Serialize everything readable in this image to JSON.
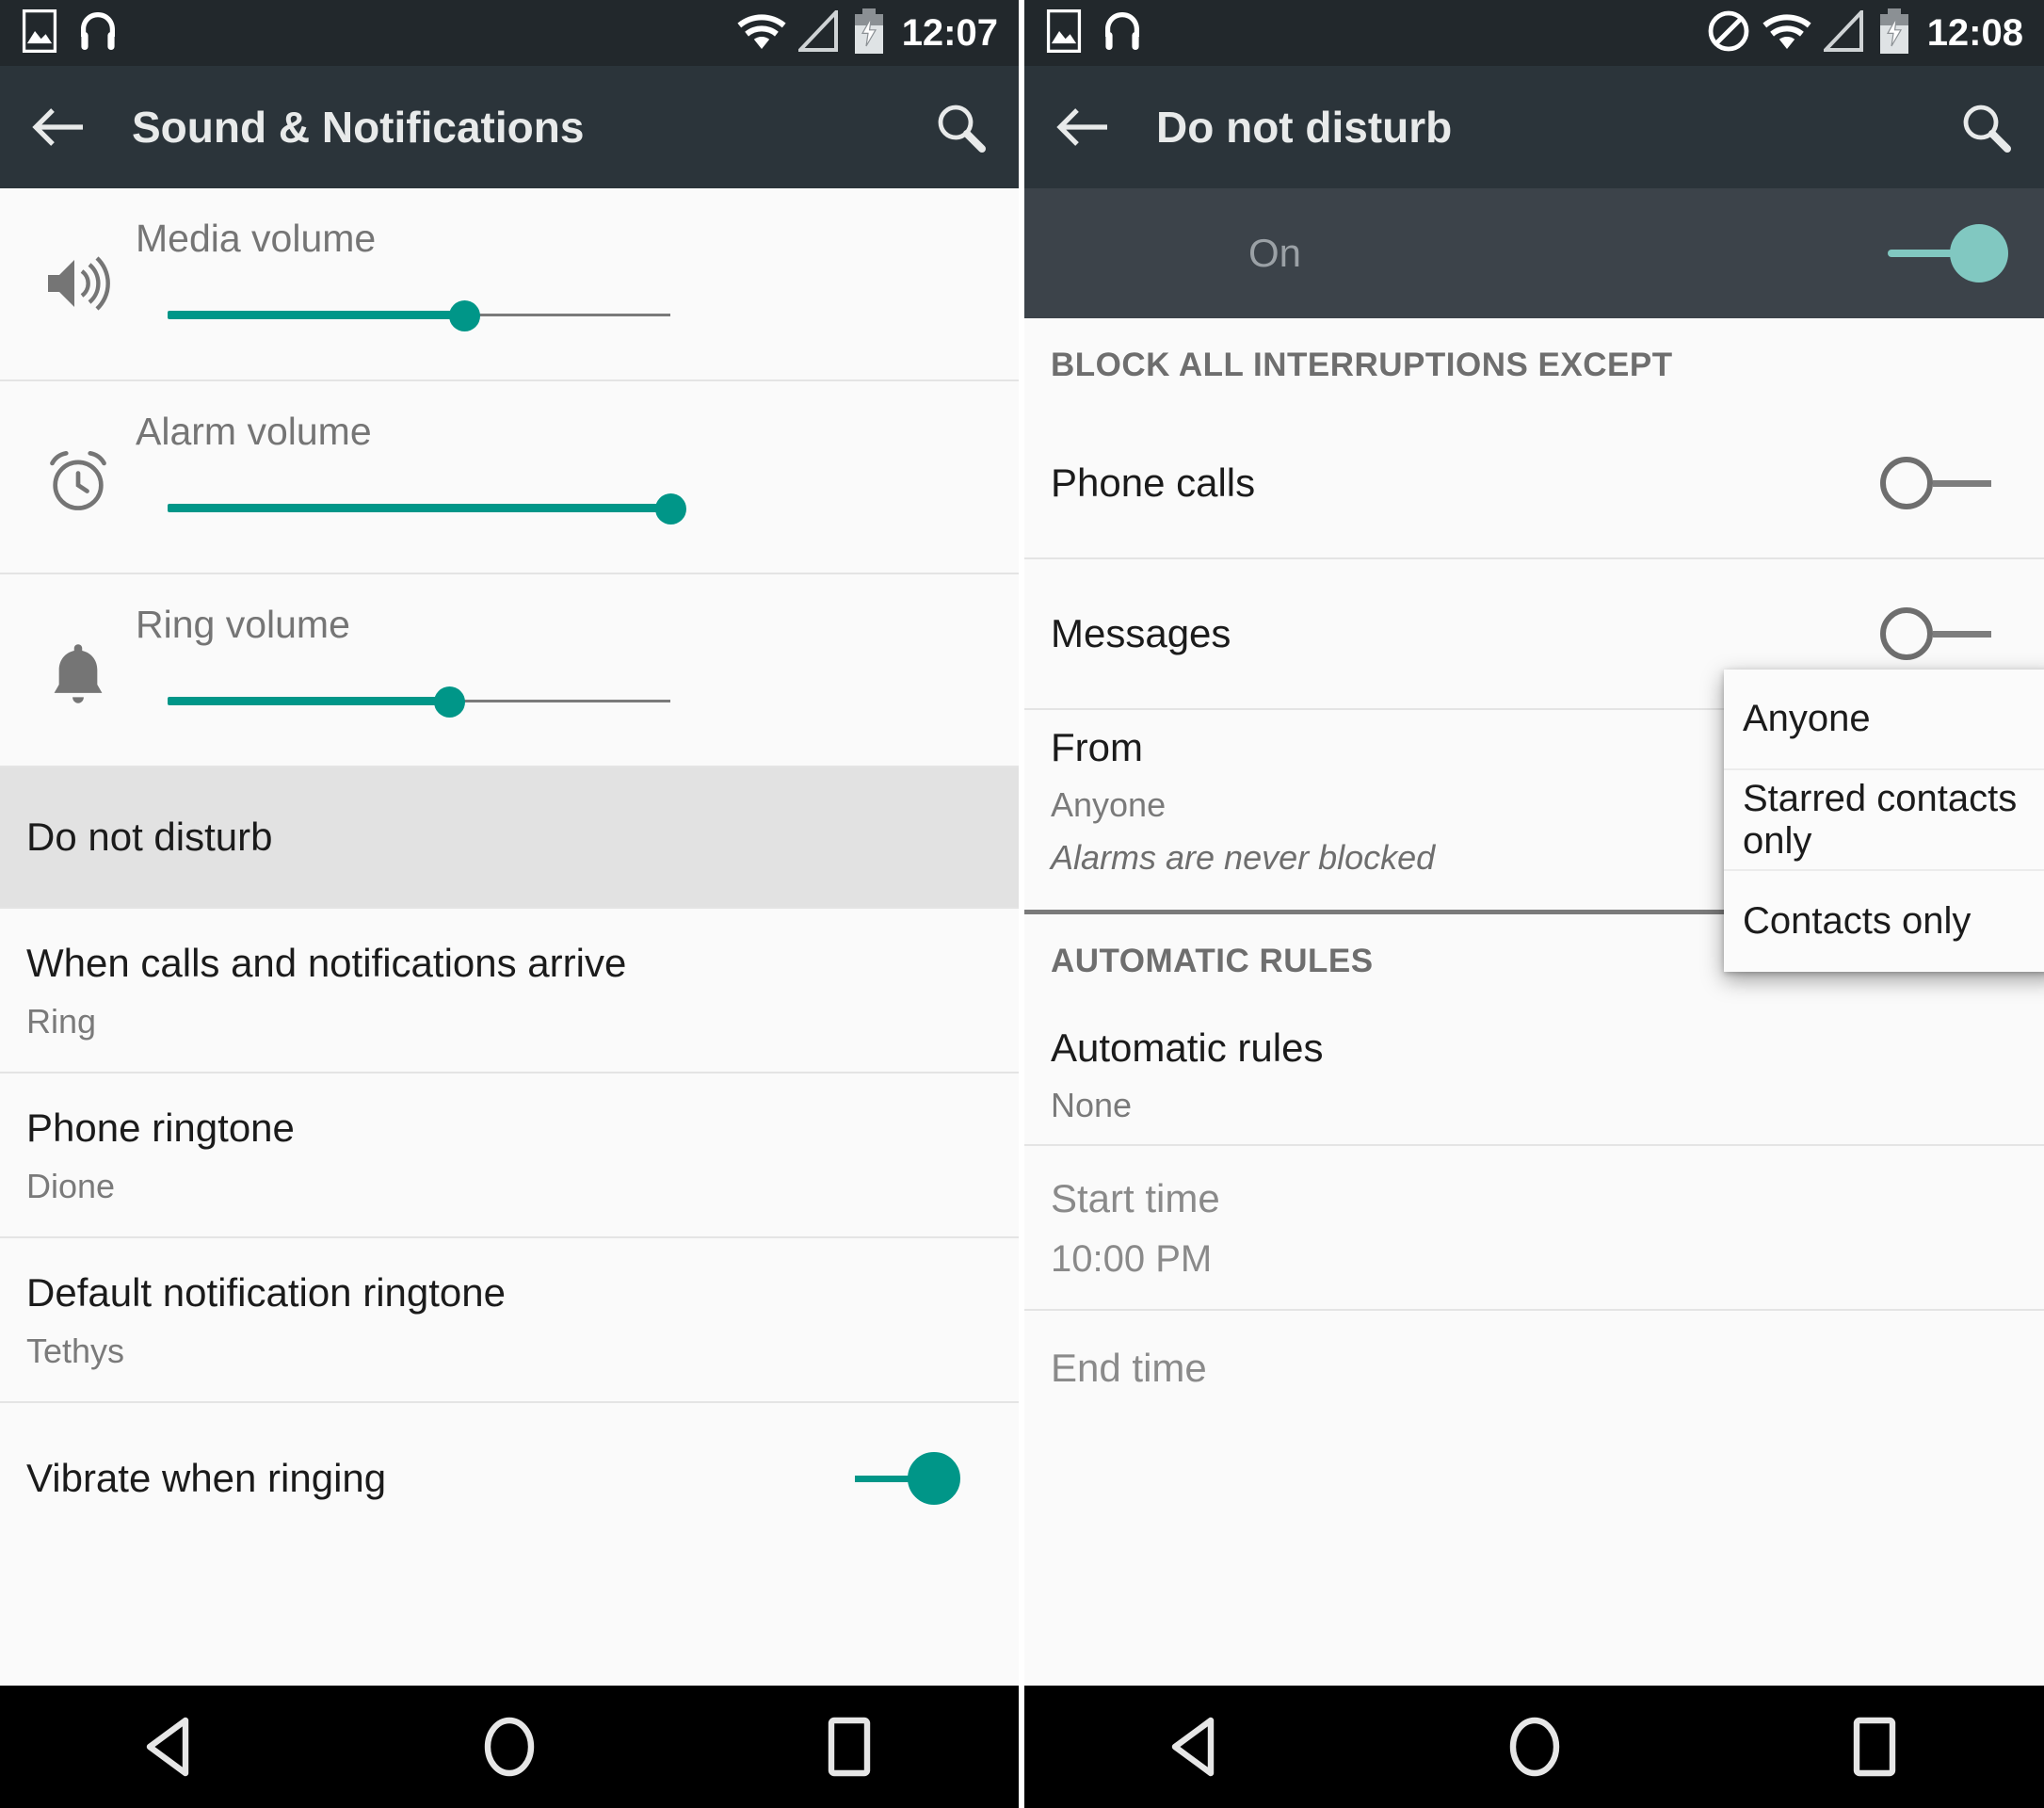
{
  "left_phone": {
    "statusbar": {
      "time": "12:07",
      "icons": [
        "image-icon",
        "headphones-icon",
        "wifi-icon",
        "cell-signal-icon",
        "battery-charging-icon"
      ]
    },
    "appbar": {
      "back_label": "back-arrow",
      "title": "Sound & Notifications",
      "search_label": "search"
    },
    "sliders": [
      {
        "icon": "volume-up-icon",
        "label": "Media volume",
        "value": 59
      },
      {
        "icon": "alarm-clock-icon",
        "label": "Alarm volume",
        "value": 100
      },
      {
        "icon": "bell-icon",
        "label": "Ring volume",
        "value": 56
      }
    ],
    "items": [
      {
        "title": "Do not disturb",
        "subtitle": "",
        "selected": true
      },
      {
        "title": "When calls and notifications arrive",
        "subtitle": "Ring",
        "selected": false
      },
      {
        "title": "Phone ringtone",
        "subtitle": "Dione",
        "selected": false
      },
      {
        "title": "Default notification ringtone",
        "subtitle": "Tethys",
        "selected": false
      }
    ],
    "toggle_item": {
      "title": "Vibrate when ringing",
      "state": "on"
    }
  },
  "right_phone": {
    "statusbar": {
      "time": "12:08",
      "icons": [
        "image-icon",
        "headphones-icon",
        "do-not-disturb-icon",
        "wifi-icon",
        "cell-signal-icon",
        "battery-charging-icon"
      ]
    },
    "appbar": {
      "back_label": "back-arrow",
      "title": "Do not disturb",
      "search_label": "search"
    },
    "master_switch": {
      "label": "On",
      "state": "on"
    },
    "section_block": "BLOCK ALL INTERRUPTIONS EXCEPT",
    "exceptions": [
      {
        "title": "Phone calls",
        "state": "off"
      },
      {
        "title": "Messages",
        "state": "off"
      }
    ],
    "from_item": {
      "title": "From",
      "subtitle": "Anyone"
    },
    "note": "Alarms are never blocked",
    "section_auto": "AUTOMATIC RULES",
    "auto_item": {
      "title": "Automatic rules",
      "subtitle": "None"
    },
    "times": [
      {
        "title": "Start time",
        "subtitle": "10:00 PM"
      },
      {
        "title": "End time",
        "subtitle": ""
      }
    ],
    "dropdown": {
      "options": [
        "Anyone",
        "Starred contacts only",
        "Contacts only"
      ],
      "selected": "Anyone"
    }
  },
  "navbar": {
    "buttons": [
      "back-triangle-icon",
      "home-circle-icon",
      "recents-square-icon"
    ]
  },
  "colors": {
    "statusbar_bg": "#22282c",
    "appbar_bg": "#2b343a",
    "accent_teal": "#009688",
    "accent_teal_light": "#81c8c1",
    "list_bg": "#fafafa",
    "selected_row": "#e2e2e2",
    "navbar_bg": "#000000"
  }
}
